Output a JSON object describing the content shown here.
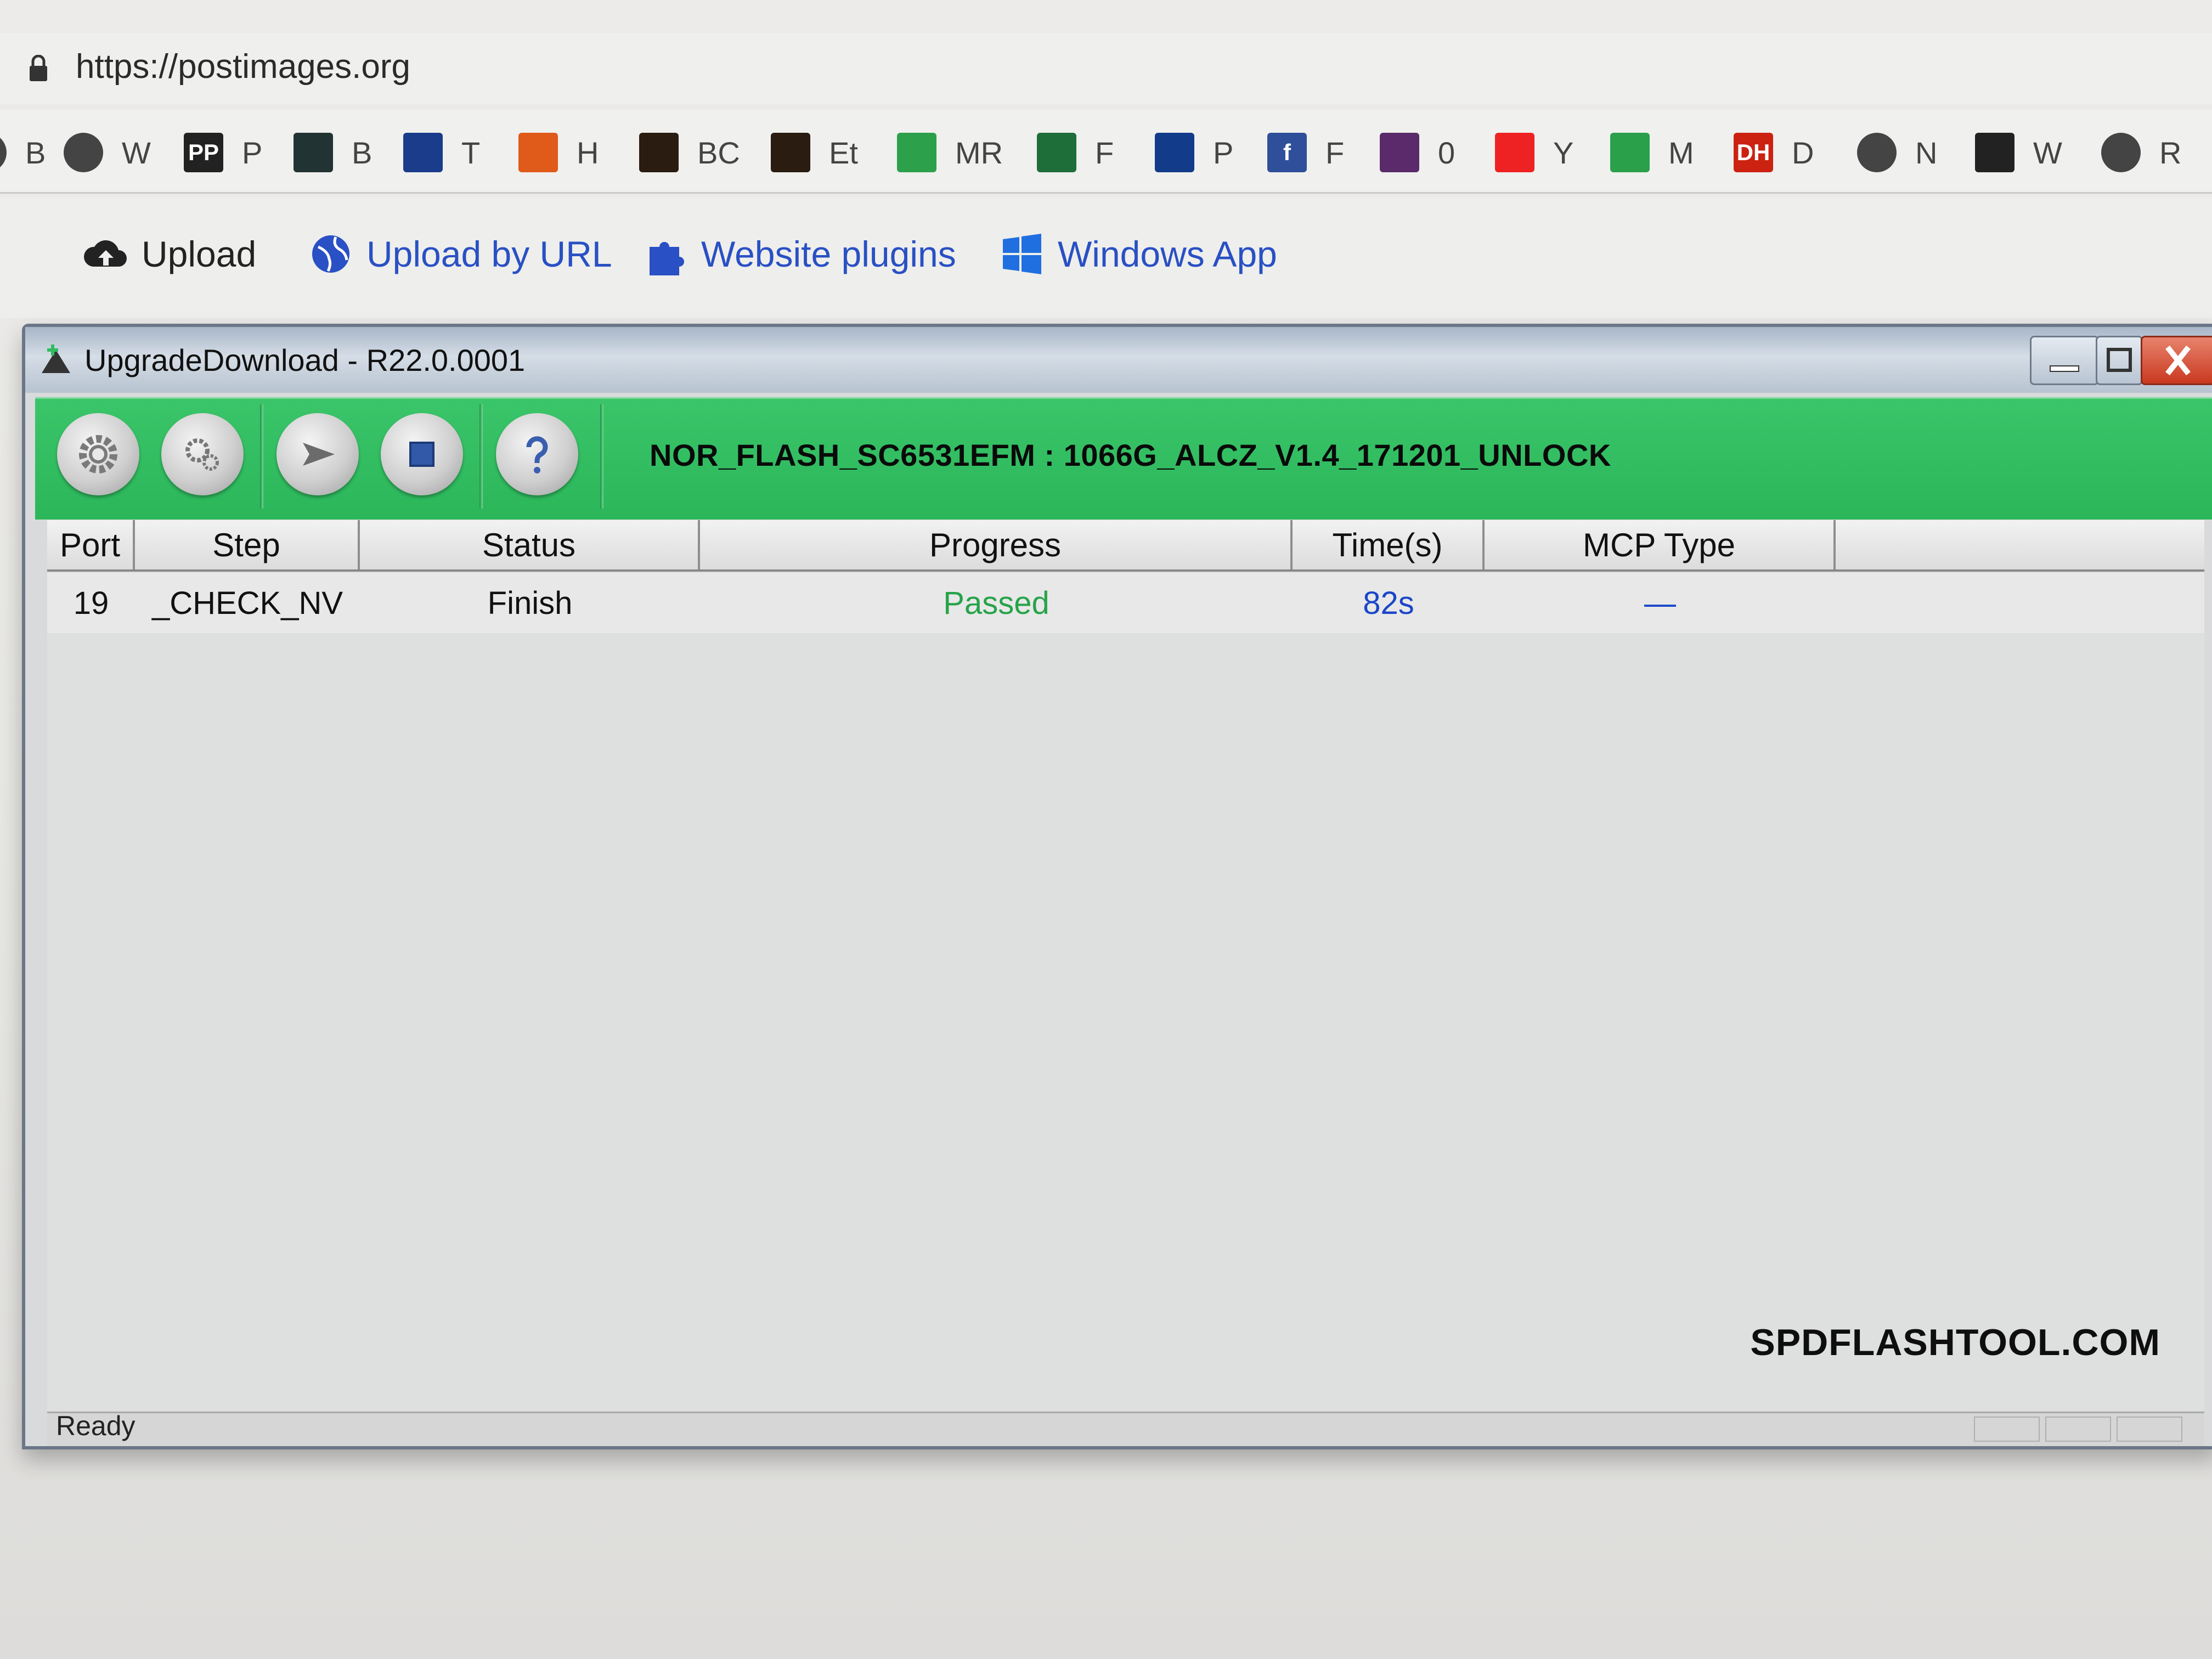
{
  "browser": {
    "url": "https://postimages.org",
    "bookmarks": [
      {
        "icon": "globe-icon",
        "label": "B"
      },
      {
        "icon": "globe-icon",
        "label": "W"
      },
      {
        "icon": "pp-icon",
        "label": "P",
        "text": "PP"
      },
      {
        "icon": "cross-grid-icon",
        "label": "B"
      },
      {
        "icon": "blue-box-icon",
        "label": "T"
      },
      {
        "icon": "flame-icon",
        "label": "H"
      },
      {
        "icon": "tool-grid-icon",
        "label": "BC"
      },
      {
        "icon": "tool-grid-icon",
        "label": "Et"
      },
      {
        "icon": "windows-color-icon",
        "label": "MR"
      },
      {
        "icon": "green-circle-icon",
        "label": "F"
      },
      {
        "icon": "paypal-icon",
        "label": "P"
      },
      {
        "icon": "facebook-icon",
        "label": "F",
        "text": "f"
      },
      {
        "icon": "phone-circle-icon",
        "label": "0"
      },
      {
        "icon": "youtube-icon",
        "label": "Y"
      },
      {
        "icon": "maps-icon",
        "label": "M"
      },
      {
        "icon": "dh-icon",
        "label": "D",
        "text": "DH"
      },
      {
        "icon": "globe-icon",
        "label": "N"
      },
      {
        "icon": "robot-icon",
        "label": "W"
      },
      {
        "icon": "globe-icon",
        "label": "R"
      }
    ]
  },
  "site_nav": {
    "upload": "Upload",
    "upload_by_url": "Upload by URL",
    "website_plugins": "Website plugins",
    "windows_app": "Windows App"
  },
  "window": {
    "title": "UpgradeDownload - R22.0.0001",
    "toolbar_info": "NOR_FLASH_SC6531EFM : 1066G_ALCZ_V1.4_171201_UNLOCK",
    "toolbar_buttons": [
      {
        "icon": "gear-icon"
      },
      {
        "icon": "gears-icon"
      },
      {
        "icon": "play-icon"
      },
      {
        "icon": "stop-icon"
      },
      {
        "icon": "help-icon",
        "text": "?"
      }
    ],
    "columns": [
      "Port",
      "Step",
      "Status",
      "Progress",
      "Time(s)",
      "MCP Type"
    ],
    "rows": [
      {
        "port": "19",
        "step": "_CHECK_NV",
        "status": "Finish",
        "progress": "Passed",
        "time": "82s",
        "mcp_type": "—"
      }
    ],
    "status_text": "Ready",
    "watermark": "SPDFLASHTOOL.COM"
  },
  "colors": {
    "toolbar_green": "#2fbb60",
    "passed_green": "#27a34a",
    "time_blue": "#1a46c9",
    "link_blue": "#2950c4"
  }
}
